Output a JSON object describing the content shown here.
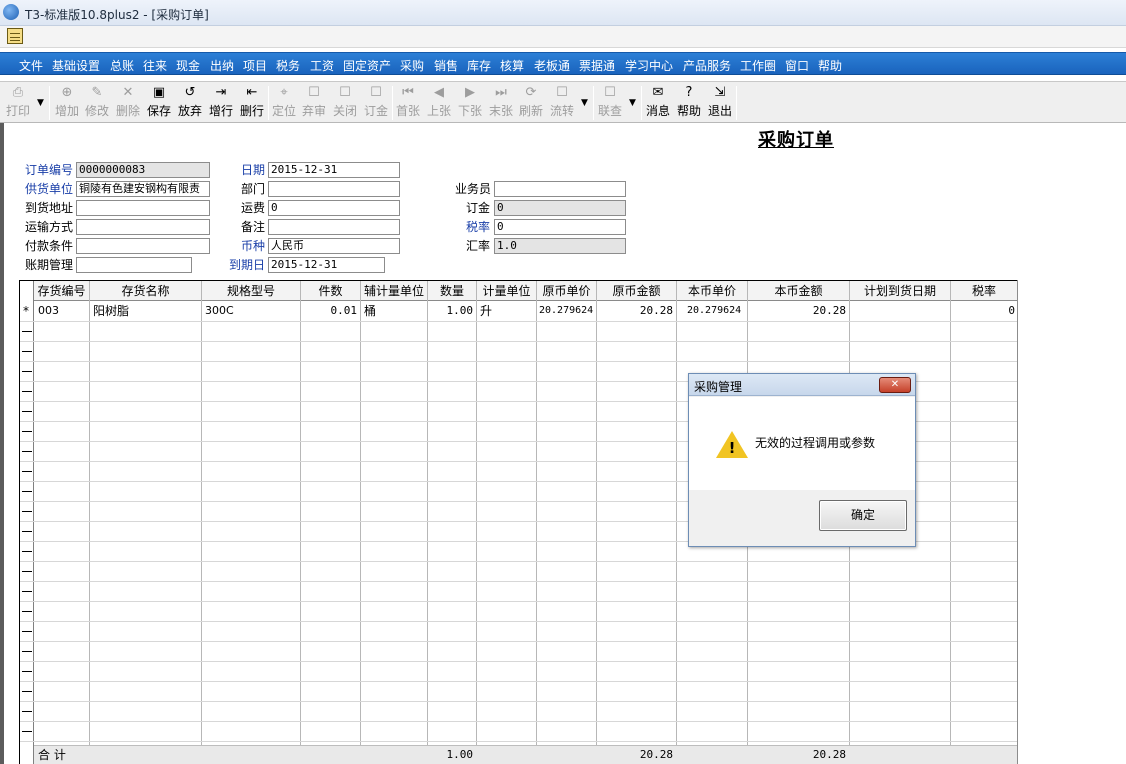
{
  "window": {
    "title": "T3-标准版10.8plus2 - [采购订单]"
  },
  "menubar": {
    "items": [
      "文件",
      "基础设置",
      "总账",
      "往来",
      "现金",
      "出纳",
      "项目",
      "税务",
      "工资",
      "固定资产",
      "采购",
      "销售",
      "库存",
      "核算",
      "老板通",
      "票据通",
      "学习中心",
      "产品服务",
      "工作圈",
      "窗口",
      "帮助"
    ]
  },
  "toolbar": {
    "buttons": [
      {
        "label": "打印",
        "icon": "printer-icon",
        "enabled": false
      },
      {
        "label": "增加",
        "icon": "add-icon",
        "enabled": false
      },
      {
        "label": "修改",
        "icon": "edit-icon",
        "enabled": false
      },
      {
        "label": "删除",
        "icon": "delete-icon",
        "enabled": false
      },
      {
        "label": "保存",
        "icon": "save-icon",
        "enabled": true
      },
      {
        "label": "放弃",
        "icon": "discard-icon",
        "enabled": true
      },
      {
        "label": "增行",
        "icon": "add-row-icon",
        "enabled": true
      },
      {
        "label": "删行",
        "icon": "delete-row-icon",
        "enabled": true
      },
      {
        "label": "定位",
        "icon": "locate-icon",
        "enabled": false
      },
      {
        "label": "弃审",
        "icon": "unaudit-icon",
        "enabled": false
      },
      {
        "label": "关闭",
        "icon": "close-doc-icon",
        "enabled": false
      },
      {
        "label": "订金",
        "icon": "deposit-icon",
        "enabled": false
      },
      {
        "label": "首张",
        "icon": "first-icon",
        "enabled": false
      },
      {
        "label": "上张",
        "icon": "prev-icon",
        "enabled": false
      },
      {
        "label": "下张",
        "icon": "next-icon",
        "enabled": false
      },
      {
        "label": "末张",
        "icon": "last-icon",
        "enabled": false
      },
      {
        "label": "刷新",
        "icon": "refresh-icon",
        "enabled": false
      },
      {
        "label": "流转",
        "icon": "flow-icon",
        "enabled": false
      },
      {
        "label": "联查",
        "icon": "linked-query-icon",
        "enabled": false
      },
      {
        "label": "消息",
        "icon": "message-icon",
        "enabled": true
      },
      {
        "label": "帮助",
        "icon": "help-icon",
        "enabled": true
      },
      {
        "label": "退出",
        "icon": "exit-icon",
        "enabled": true
      }
    ]
  },
  "form": {
    "title": "采购订单",
    "fields": {
      "order_no": {
        "label": "订单编号",
        "value": "0000000083"
      },
      "date": {
        "label": "日期",
        "value": "2015-12-31"
      },
      "supplier": {
        "label": "供货单位",
        "value": "铜陵有色建安钢构有限责"
      },
      "department": {
        "label": "部门",
        "value": ""
      },
      "salesman": {
        "label": "业务员",
        "value": ""
      },
      "delivery_address": {
        "label": "到货地址",
        "value": ""
      },
      "freight": {
        "label": "运费",
        "value": "0"
      },
      "deposit": {
        "label": "订金",
        "value": "0"
      },
      "transport": {
        "label": "运输方式",
        "value": ""
      },
      "remark": {
        "label": "备注",
        "value": ""
      },
      "tax_rate": {
        "label": "税率",
        "value": "0"
      },
      "payment_terms": {
        "label": "付款条件",
        "value": ""
      },
      "currency": {
        "label": "币种",
        "value": "人民币"
      },
      "exchange_rate": {
        "label": "汇率",
        "value": "1.0"
      },
      "account_period": {
        "label": "账期管理",
        "value": ""
      },
      "due_date": {
        "label": "到期日",
        "value": "2015-12-31"
      }
    }
  },
  "grid": {
    "columns": [
      "存货编号",
      "存货名称",
      "规格型号",
      "件数",
      "辅计量单位",
      "数量",
      "计量单位",
      "原币单价",
      "原币金额",
      "本币单价",
      "本币金额",
      "计划到货日期",
      "税率"
    ],
    "rows": [
      {
        "marker": "*",
        "code": "003",
        "name": "阳树脂",
        "spec": "300C",
        "pieces": "0.01",
        "aux_unit": "桶",
        "qty": "1.00",
        "unit": "升",
        "orig_price": "20.279624",
        "orig_amount": "20.28",
        "local_price": "20.279624",
        "local_amount": "20.28",
        "plan_date": "",
        "tax_rate": "0"
      }
    ],
    "totals": {
      "label": "合  计",
      "qty": "1.00",
      "orig_amount": "20.28",
      "local_amount": "20.28"
    }
  },
  "dialog": {
    "title": "采购管理",
    "message": "无效的过程调用或参数",
    "ok_label": "确定",
    "close_label": "✕"
  }
}
